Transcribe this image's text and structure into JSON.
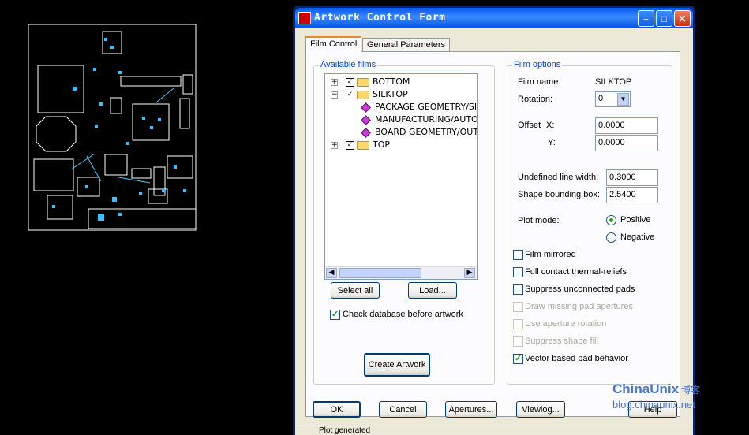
{
  "window": {
    "title": "Artwork Control Form",
    "min_icon": "minimize-icon",
    "max_icon": "maximize-icon",
    "close_icon": "close-icon"
  },
  "tabs": [
    "Film Control",
    "General Parameters"
  ],
  "available_films": {
    "label": "Available films",
    "items": [
      {
        "name": "BOTTOM",
        "expander": "+",
        "checked": true
      },
      {
        "name": "SILKTOP",
        "expander": "-",
        "checked": true
      },
      {
        "name": "PACKAGE GEOMETRY/SI"
      },
      {
        "name": "MANUFACTURING/AUTO"
      },
      {
        "name": "BOARD GEOMETRY/OUT"
      },
      {
        "name": "TOP",
        "expander": "+",
        "checked": true
      }
    ],
    "select_all": "Select all",
    "load": "Load...",
    "check_db": "Check database before artwork",
    "create": "Create Artwork"
  },
  "film_options": {
    "label": "Film options",
    "film_name_label": "Film name:",
    "film_name": "SILKTOP",
    "rotation_label": "Rotation:",
    "rotation": "0",
    "offset_label": "Offset",
    "x_label": "X:",
    "y_label": "Y:",
    "offset_x": "0.0000",
    "offset_y": "0.0000",
    "undef_label": "Undefined line width:",
    "undef": "0.3000",
    "shape_label": "Shape bounding box:",
    "shape": "2.5400",
    "plot_mode_label": "Plot mode:",
    "positive": "Positive",
    "negative": "Negative",
    "film_mirrored": "Film mirrored",
    "full_contact": "Full contact thermal-reliefs",
    "suppress_unconnected": "Suppress unconnected pads",
    "draw_missing": "Draw missing pad apertures",
    "use_aperture": "Use aperture rotation",
    "suppress_fill": "Suppress shape fill",
    "vector_pad": "Vector based pad behavior"
  },
  "buttons": {
    "ok": "OK",
    "cancel": "Cancel",
    "apertures": "Apertures...",
    "viewlog": "Viewlog...",
    "help": "Help"
  },
  "status": "Plot generated",
  "watermark": {
    "brand": "ChinaUnix",
    "cjk": "博客",
    "url": "blog.chinaunix.net"
  }
}
